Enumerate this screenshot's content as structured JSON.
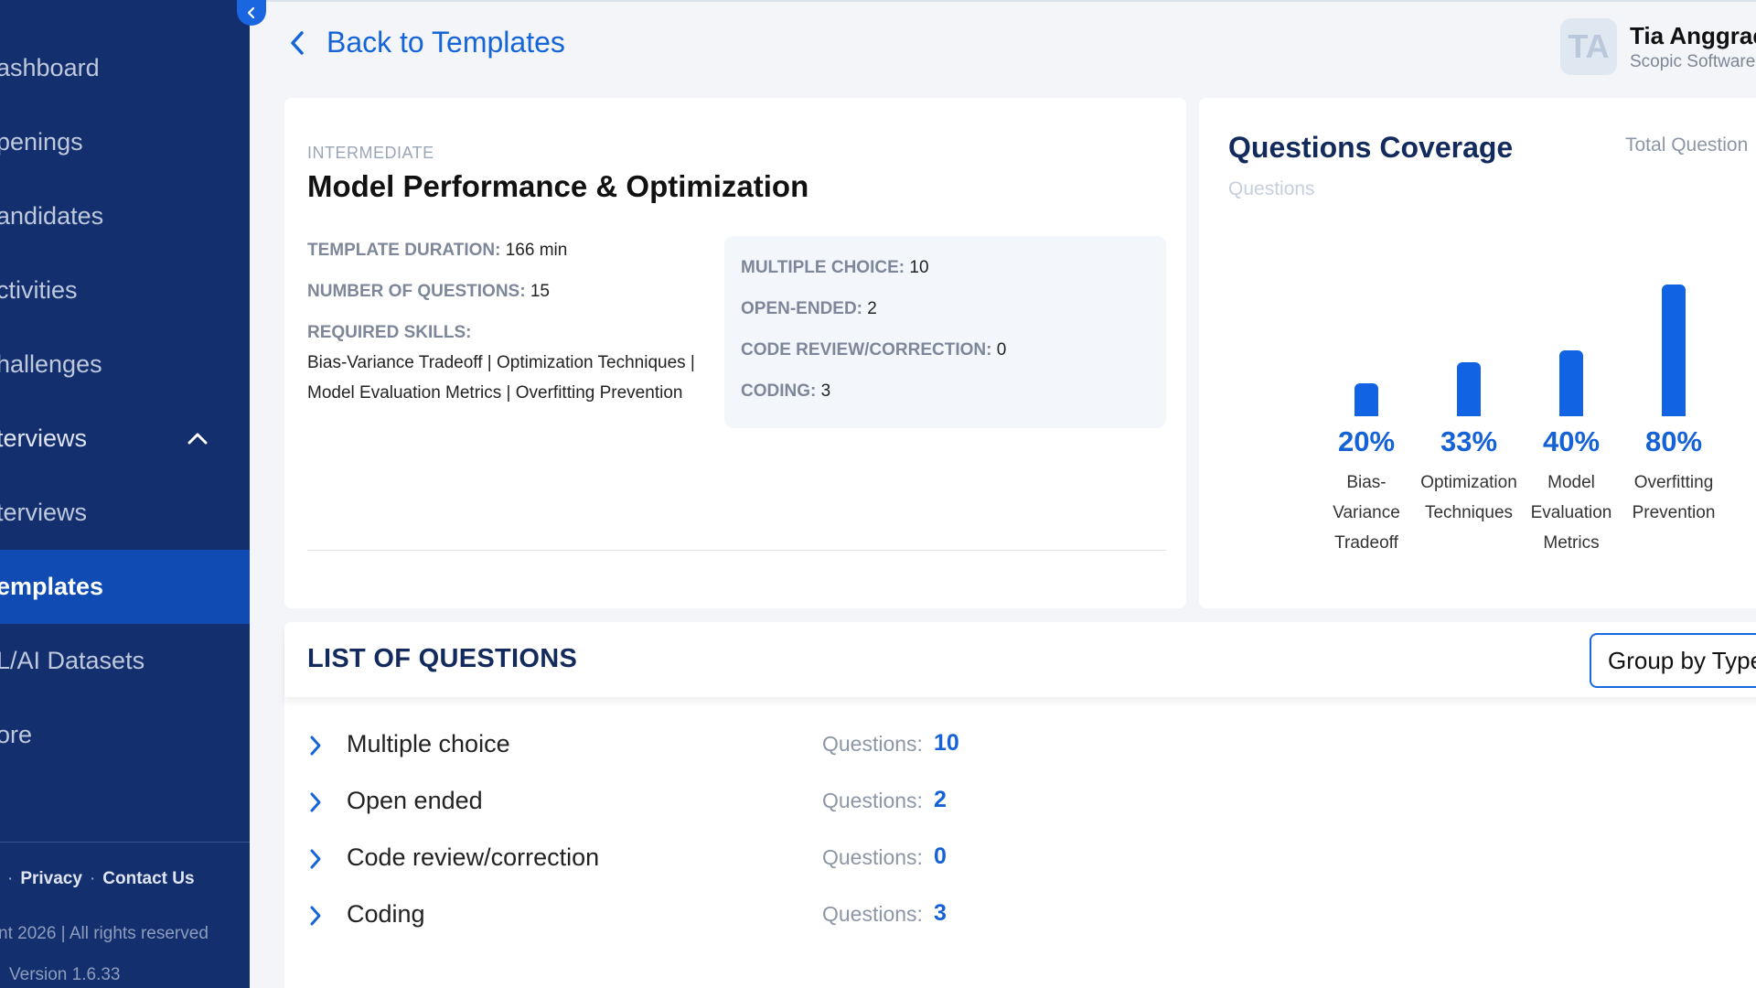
{
  "sidebar": {
    "items": [
      {
        "label": "ashboard"
      },
      {
        "label": "penings"
      },
      {
        "label": "andidates"
      },
      {
        "label": "ctivities"
      },
      {
        "label": "hallenges"
      },
      {
        "label": "terviews"
      },
      {
        "label": "terviews"
      },
      {
        "label": "emplates"
      },
      {
        "label": "L/AI Datasets"
      },
      {
        "label": "ore"
      }
    ],
    "footer": {
      "privacy": "Privacy",
      "contact": "Contact Us",
      "separator": "·",
      "copyright": "nt 2026 | All rights reserved",
      "version": "Version 1.6.33"
    }
  },
  "header": {
    "back_label": "Back to Templates",
    "user": {
      "initials": "TA",
      "name": "Tia Anggrae",
      "org": "Scopic Software"
    }
  },
  "template": {
    "level": "INTERMEDIATE",
    "title": "Model Performance & Optimization",
    "duration_key": "TEMPLATE DURATION:",
    "duration_val": "166 min",
    "questions_key": "NUMBER OF QUESTIONS:",
    "questions_val": "15",
    "skills_key": "REQUIRED SKILLS:",
    "skills_val": "Bias-Variance Tradeoff | Optimization Techniques | Model Evaluation Metrics | Overfitting Prevention",
    "types": [
      {
        "key": "MULTIPLE CHOICE:",
        "val": "10"
      },
      {
        "key": "OPEN-ENDED:",
        "val": "2"
      },
      {
        "key": "CODE REVIEW/CORRECTION:",
        "val": "0"
      },
      {
        "key": "CODING:",
        "val": "3"
      }
    ]
  },
  "coverage": {
    "title": "Questions Coverage",
    "subtitle": "Questions",
    "total_label": "Total Question"
  },
  "chart_data": {
    "type": "bar",
    "title": "Questions Coverage",
    "ylabel": "Questions",
    "categories": [
      "Bias-Variance Tradeoff",
      "Optimization Techniques",
      "Model Evaluation Metrics",
      "Overfitting Prevention"
    ],
    "values": [
      20,
      33,
      40,
      80
    ],
    "value_labels": [
      "20%",
      "33%",
      "40%",
      "80%"
    ],
    "label_lines": [
      [
        "Bias-",
        "Variance",
        "Tradeoff"
      ],
      [
        "Optimization",
        "Techniques"
      ],
      [
        "Model",
        "Evaluation",
        "Metrics"
      ],
      [
        "Overfitting",
        "Prevention"
      ]
    ],
    "ylim": [
      0,
      100
    ],
    "color": "#1163e4",
    "grid": false
  },
  "questions": {
    "title": "LIST OF QUESTIONS",
    "group_by": "Group by Type",
    "rows": [
      {
        "name": "Multiple choice",
        "key": "Questions:",
        "val": "10"
      },
      {
        "name": "Open ended",
        "key": "Questions:",
        "val": "2"
      },
      {
        "name": "Code review/correction",
        "key": "Questions:",
        "val": "0"
      },
      {
        "name": "Coding",
        "key": "Questions:",
        "val": "3"
      }
    ]
  },
  "colors": {
    "sidebar_bg": "#142f6e",
    "sidebar_active": "#0f4bb3",
    "accent": "#1565d8",
    "bar": "#1163e4"
  }
}
